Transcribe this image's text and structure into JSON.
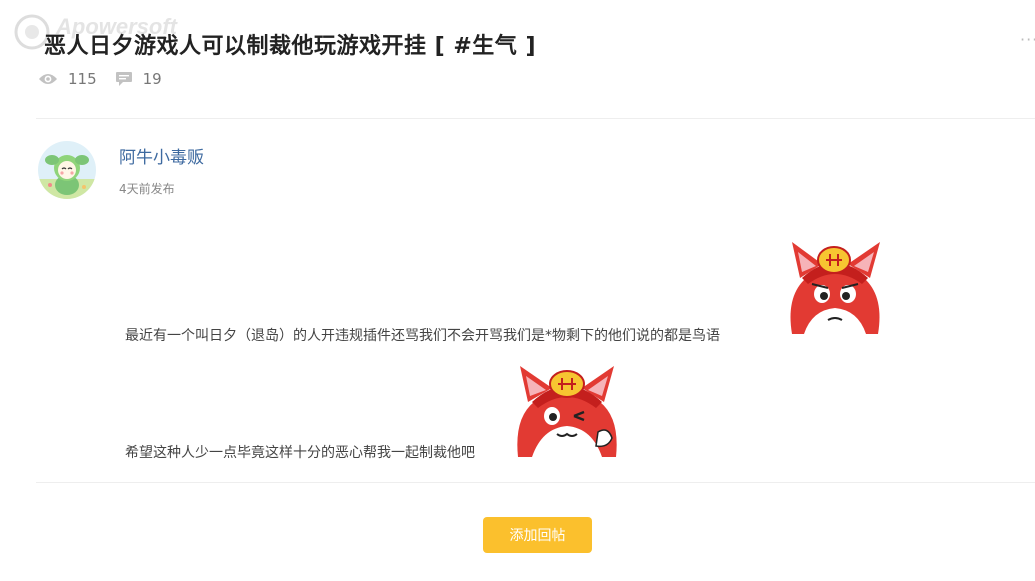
{
  "watermark": {
    "text": "Apowersoft"
  },
  "post": {
    "title": "恶人日夕游戏人可以制裁他玩游戏开挂 [ #生气 ]",
    "more_icon": "more-dots-icon",
    "views": "115",
    "views_icon": "eye-icon",
    "comments": "19",
    "comments_icon": "comment-icon"
  },
  "author": {
    "name": "阿牛小毒贩",
    "time": "4天前发布",
    "avatar_icon": "green-mascot-avatar"
  },
  "content": {
    "paragraph1": "最近有一个叫日夕（退岛）的人开违规插件还骂我们不会开骂我们是*物剩下的他们说的都是鸟语",
    "paragraph2": "希望这种人少一点毕竟这样十分的恶心帮我一起制裁他吧",
    "sticker1_icon": "red-cat-sad-sticker",
    "sticker2_icon": "red-cat-wink-sticker"
  },
  "actions": {
    "reply_label": "添加回帖"
  },
  "colors": {
    "accent": "#fbc02d",
    "author_link": "#3e6aa0"
  }
}
